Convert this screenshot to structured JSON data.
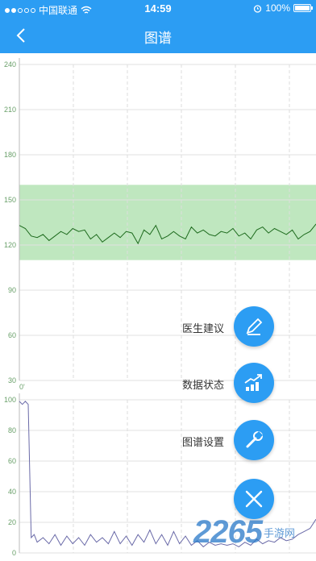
{
  "status_bar": {
    "carrier": "中国联通",
    "time": "14:59",
    "battery": "100%",
    "battery_level": 1.0,
    "signal_bars": 2
  },
  "nav": {
    "back_icon": "chevron-left-icon",
    "title": "图谱"
  },
  "chart_data": [
    {
      "type": "line",
      "name": "upper-chart",
      "ylim": [
        30,
        240
      ],
      "yticks": [
        "240",
        "210",
        "180",
        "150",
        "120",
        "90",
        "60",
        "30"
      ],
      "xticks": [
        "0'"
      ],
      "band": {
        "from": 110,
        "to": 160,
        "color": "#bfe7bf"
      },
      "grid": true,
      "series": [
        {
          "color": "#1e6b1e",
          "x": [
            0,
            2,
            4,
            6,
            8,
            10,
            12,
            14,
            16,
            18,
            20,
            22,
            24,
            26,
            28,
            30,
            32,
            34,
            36,
            38,
            40,
            42,
            44,
            46,
            48,
            50,
            52,
            54,
            56,
            58,
            60,
            62,
            64,
            66,
            68,
            70,
            72,
            74,
            76,
            78,
            80,
            82,
            84,
            86,
            88,
            90,
            92,
            94,
            96,
            98,
            100
          ],
          "y": [
            133,
            131,
            126,
            125,
            127,
            123,
            126,
            129,
            127,
            131,
            129,
            130,
            124,
            127,
            122,
            125,
            128,
            125,
            129,
            128,
            121,
            130,
            127,
            133,
            124,
            126,
            129,
            126,
            124,
            132,
            128,
            130,
            127,
            126,
            129,
            128,
            131,
            126,
            128,
            124,
            130,
            132,
            128,
            131,
            129,
            127,
            130,
            124,
            127,
            129,
            134
          ]
        }
      ]
    },
    {
      "type": "line",
      "name": "lower-chart",
      "ylim": [
        0,
        100
      ],
      "yticks": [
        "100",
        "80",
        "60",
        "40",
        "20",
        "0"
      ],
      "grid": true,
      "series": [
        {
          "color": "#6a6aa8",
          "x": [
            0,
            1,
            2,
            3,
            4,
            5,
            6,
            8,
            10,
            12,
            14,
            16,
            18,
            20,
            22,
            24,
            26,
            28,
            30,
            32,
            34,
            36,
            38,
            40,
            42,
            44,
            46,
            48,
            50,
            52,
            54,
            56,
            58,
            60,
            62,
            64,
            66,
            68,
            70,
            72,
            74,
            76,
            78,
            80,
            82,
            84,
            86,
            88,
            90,
            92,
            94,
            96,
            98,
            100
          ],
          "y": [
            99,
            97,
            99,
            97,
            10,
            12,
            7,
            10,
            6,
            12,
            5,
            11,
            6,
            10,
            5,
            12,
            7,
            10,
            6,
            14,
            6,
            11,
            5,
            12,
            7,
            15,
            6,
            12,
            5,
            14,
            6,
            11,
            5,
            8,
            4,
            7,
            5,
            6,
            5,
            6,
            4,
            7,
            5,
            9,
            6,
            8,
            7,
            10,
            8,
            9,
            12,
            14,
            16,
            22
          ]
        }
      ]
    }
  ],
  "actions": [
    {
      "label": "医生建议",
      "icon": "pen-icon"
    },
    {
      "label": "数据状态",
      "icon": "trend-chart-icon"
    },
    {
      "label": "图谱设置",
      "icon": "wrench-icon"
    }
  ],
  "close_icon": "close-icon",
  "watermark": {
    "number": "2265",
    "text": "手游网"
  },
  "colors": {
    "primary": "#2c9df3",
    "band": "#bfe7bf",
    "upper_line": "#1e6b1e",
    "lower_line": "#6a6aa8",
    "tick_label": "#6aa06a"
  }
}
